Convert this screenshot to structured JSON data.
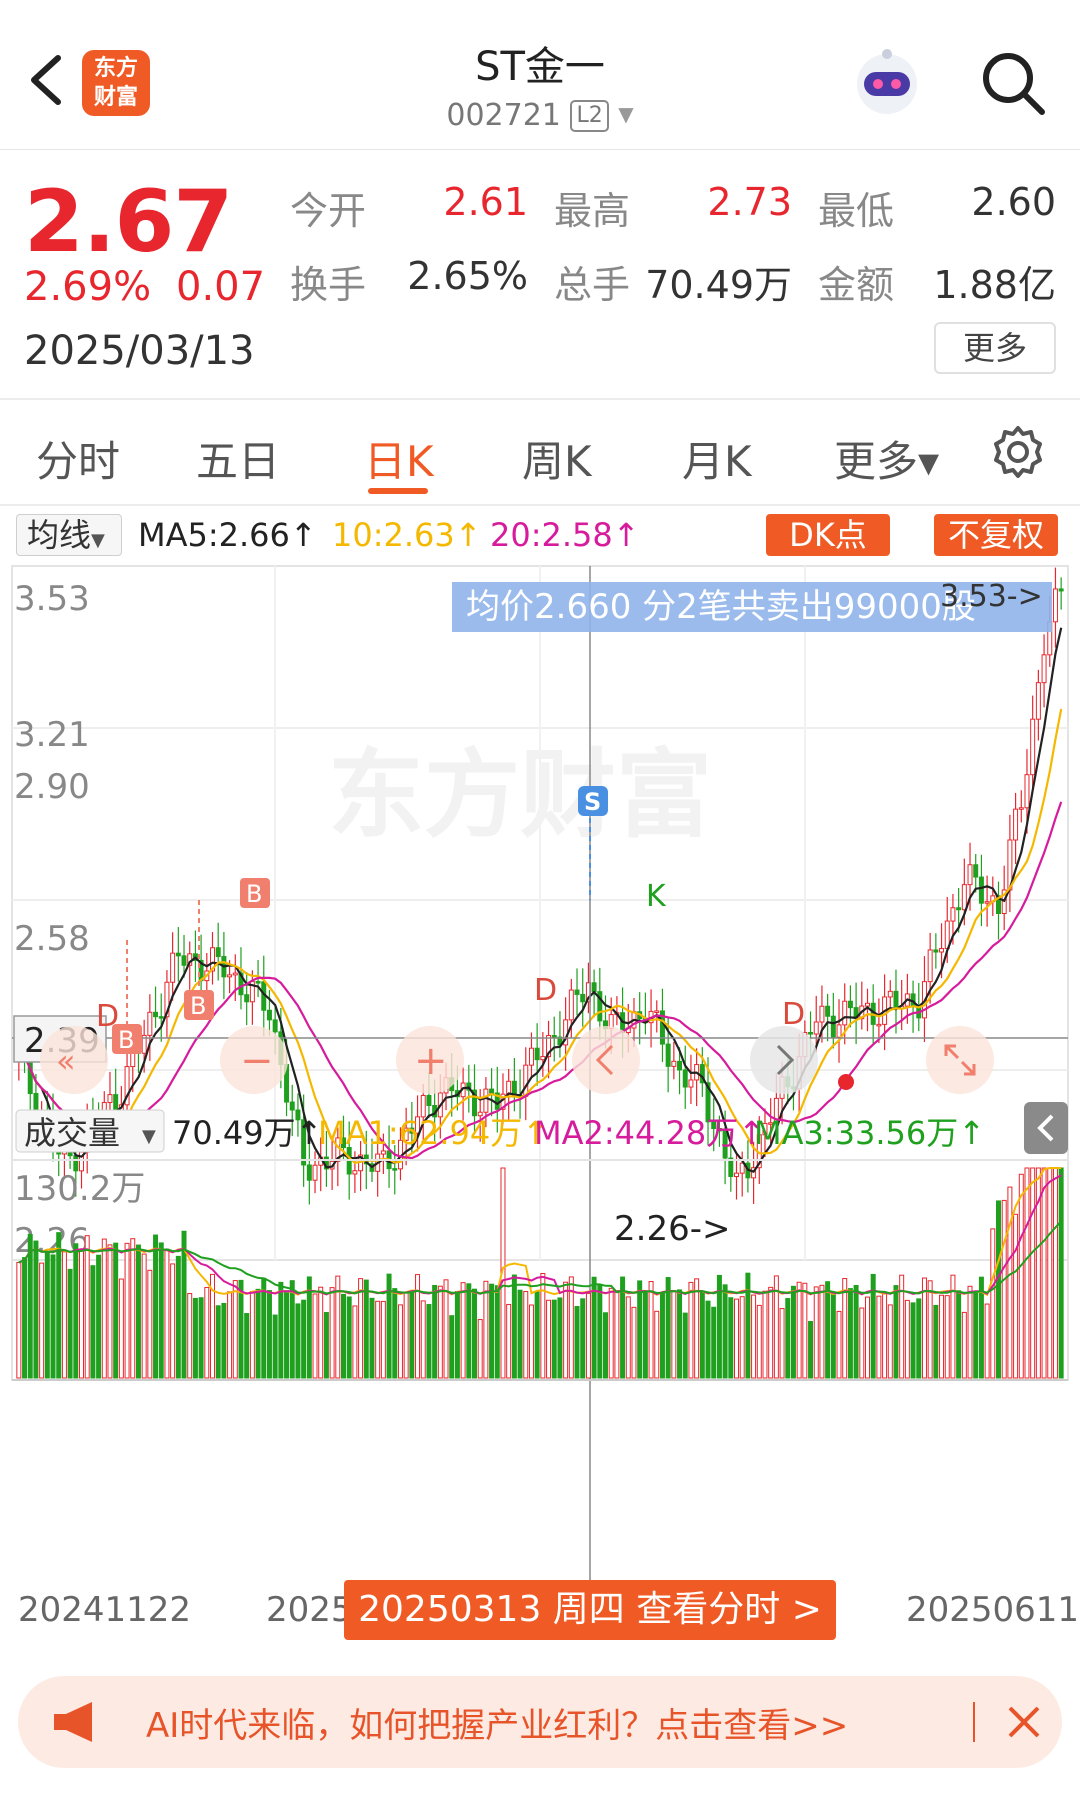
{
  "header": {
    "logo_text_line1": "东方",
    "logo_text_line2": "财富",
    "title": "ST金一",
    "code": "002721",
    "level_badge": "L2"
  },
  "quote": {
    "price": "2.67",
    "change_pct": "2.69%",
    "change_abs": "0.07",
    "date": "2025/03/13",
    "fields": [
      {
        "label": "今开",
        "value": "2.61",
        "color": "#e8262e"
      },
      {
        "label": "最高",
        "value": "2.73",
        "color": "#e8262e"
      },
      {
        "label": "最低",
        "value": "2.60",
        "color": "#333333"
      },
      {
        "label": "换手",
        "value": "2.65%",
        "color": "#333333"
      },
      {
        "label": "总手",
        "value": "70.49万",
        "color": "#333333"
      },
      {
        "label": "金额",
        "value": "1.88亿",
        "color": "#333333"
      }
    ],
    "more_label": "更多"
  },
  "tabs": [
    {
      "label": "分时",
      "active": false
    },
    {
      "label": "五日",
      "active": false
    },
    {
      "label": "日K",
      "active": true
    },
    {
      "label": "周K",
      "active": false
    },
    {
      "label": "月K",
      "active": false
    },
    {
      "label": "更多▾",
      "active": false
    }
  ],
  "ma_legend": {
    "selector": "均线",
    "ma5": "MA5:2.66↑",
    "ma10": "10:2.63↑",
    "ma20": "20:2.58↑",
    "dk_button": "DK点",
    "fq_button": "不复权"
  },
  "price_axis": {
    "labels": [
      "3.53",
      "3.21",
      "2.90",
      "2.58",
      "2.26"
    ],
    "cursor_price": "2.39",
    "high_marker": "3.53->",
    "low_marker": "2.26->",
    "tooltip": "均价2.660  分2笔共卖出99000股",
    "watermark": "东方财富"
  },
  "signals": {
    "b_label": "B",
    "d_label": "D",
    "s_label": "S",
    "k_label": "K"
  },
  "volume_legend": {
    "selector": "成交量",
    "vol": "70.49万↑",
    "ma1": "MA1:62.94万↑",
    "ma2": "MA2:44.28万↑",
    "ma3": "MA3:33.56万↑",
    "axis_max": "130.2万"
  },
  "chart_controls": {
    "zoom_out": "−",
    "zoom_in": "+"
  },
  "footer": {
    "date_start": "20241122",
    "date_mid": "2025",
    "date_end": "20250611",
    "view_button": "20250313 周四 查看分时 >"
  },
  "ad": {
    "text": "AI时代来临，如何把握产业红利？点击查看>>"
  },
  "colors": {
    "accent": "#f05a24",
    "up": "#e8262e",
    "down": "#1fa01f",
    "ma5": "#222222",
    "ma10": "#f5b800",
    "ma20": "#d61c9c"
  }
}
